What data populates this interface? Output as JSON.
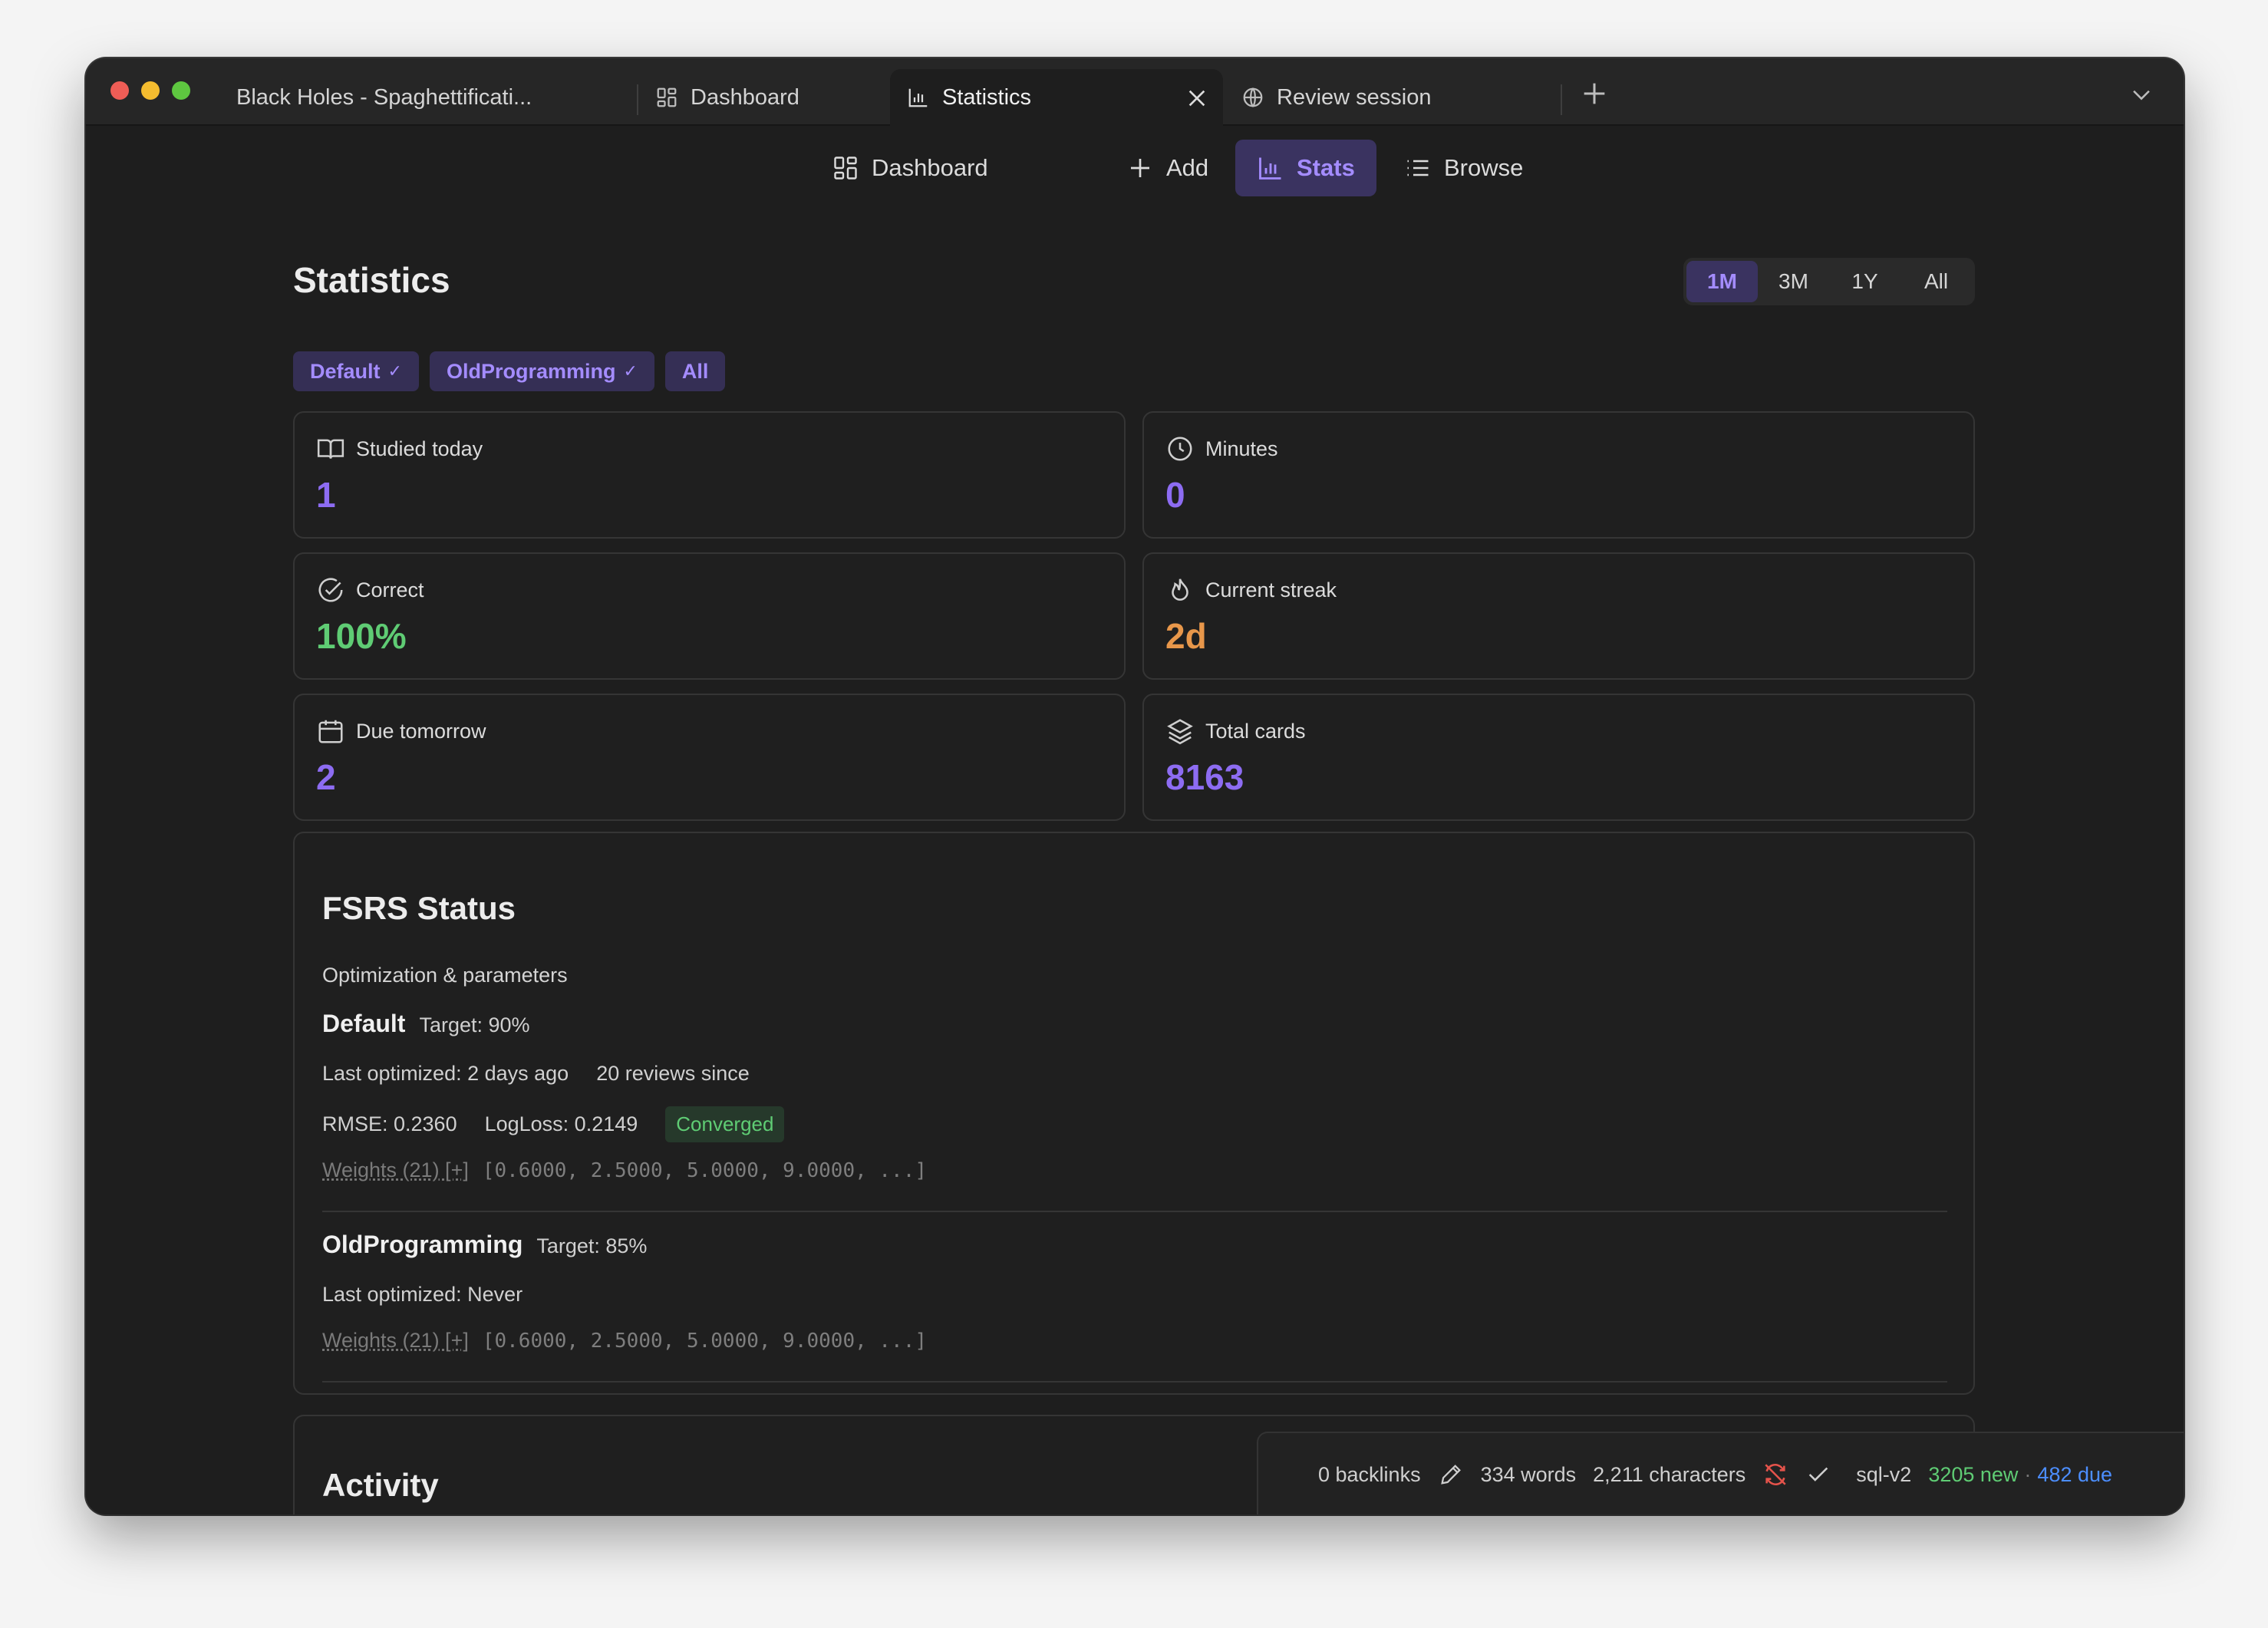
{
  "tabs": [
    {
      "label": "Black Holes - Spaghettificati...",
      "icon": "none"
    },
    {
      "label": "Dashboard",
      "icon": "dashboard-icon"
    },
    {
      "label": "Statistics",
      "icon": "bar-chart-icon",
      "active": true
    },
    {
      "label": "Review session",
      "icon": "globe-icon"
    }
  ],
  "nav": {
    "dashboard": "Dashboard",
    "add": "Add",
    "stats": "Stats",
    "browse": "Browse"
  },
  "page": {
    "title": "Statistics"
  },
  "range": {
    "options": [
      "1M",
      "3M",
      "1Y",
      "All"
    ],
    "selected": "1M"
  },
  "decks": {
    "chips": [
      {
        "label": "Default",
        "check": "✓"
      },
      {
        "label": "OldProgramming",
        "check": "✓"
      },
      {
        "label": "All",
        "check": ""
      }
    ]
  },
  "cards": {
    "studied_today": {
      "label": "Studied today",
      "value": "1"
    },
    "minutes": {
      "label": "Minutes",
      "value": "0"
    },
    "correct": {
      "label": "Correct",
      "value": "100%"
    },
    "streak": {
      "label": "Current streak",
      "value": "2d"
    },
    "due_tomorrow": {
      "label": "Due tomorrow",
      "value": "2"
    },
    "total_cards": {
      "label": "Total cards",
      "value": "8163"
    }
  },
  "fsrs": {
    "title": "FSRS Status",
    "subtitle": "Optimization & parameters",
    "default": {
      "name": "Default",
      "target": "Target: 90%",
      "last_optimized": "Last optimized: 2 days ago",
      "reviews_since": "20 reviews since",
      "rmse": "RMSE: 0.2360",
      "logloss": "LogLoss: 0.2149",
      "status": "Converged",
      "weights_label": "Weights (21) [+]",
      "weights": "[0.6000, 2.5000, 5.0000, 9.0000, ...]"
    },
    "oldprogramming": {
      "name": "OldProgramming",
      "target": "Target: 85%",
      "last_optimized": "Last optimized: Never",
      "weights_label": "Weights (21) [+]",
      "weights": "[0.6000, 2.5000, 5.0000, 9.0000, ...]"
    }
  },
  "activity": {
    "title": "Activity"
  },
  "statusbar": {
    "backlinks": "0 backlinks",
    "words": "334 words",
    "characters": "2,211 characters",
    "db": "sql-v2",
    "new": "3205 new",
    "separator": "·",
    "due": "482 due"
  },
  "colors": {
    "accent": "#8d6cf2",
    "success": "#5fcc74",
    "warning": "#e8974a",
    "link": "#4c8eff"
  }
}
